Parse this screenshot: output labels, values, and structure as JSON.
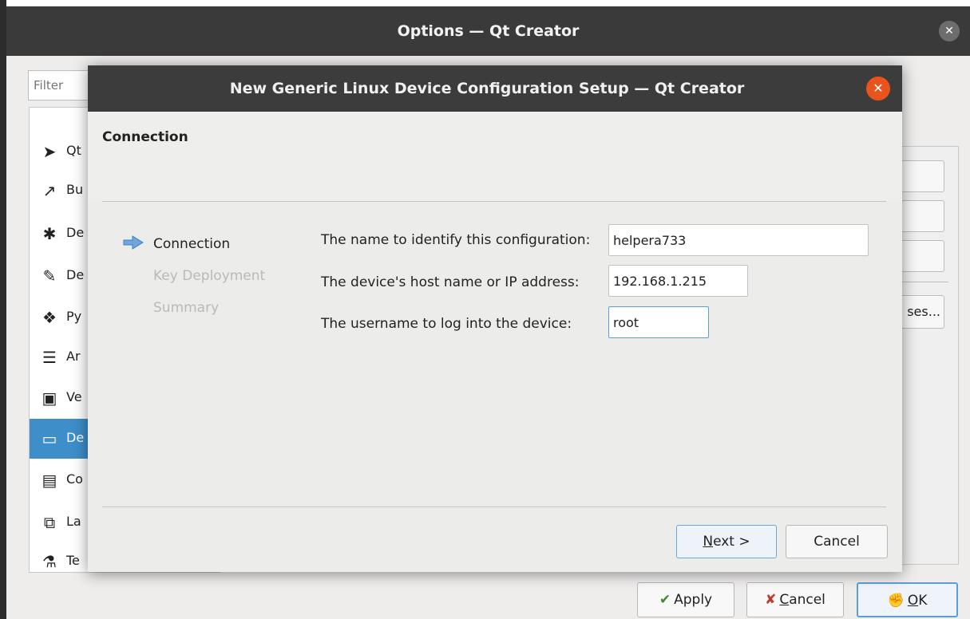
{
  "options_window": {
    "title": "Options — Qt Creator",
    "close_glyph": "✕",
    "filter_placeholder": "Filter",
    "categories": [
      {
        "label": "Qt",
        "icon": "paper-plane-icon",
        "glyph": "➤",
        "selected": false
      },
      {
        "label": "Bu",
        "icon": "hammer-icon",
        "glyph": "↗",
        "selected": false
      },
      {
        "label": "De",
        "icon": "bug-icon",
        "glyph": "✱",
        "selected": false
      },
      {
        "label": "De",
        "icon": "pencil-icon",
        "glyph": "✎",
        "selected": false
      },
      {
        "label": "Py",
        "icon": "python-icon",
        "glyph": "❖",
        "selected": false
      },
      {
        "label": "Ar",
        "icon": "text-align-icon",
        "glyph": "☰",
        "selected": false
      },
      {
        "label": "Ve",
        "icon": "version-control-icon",
        "glyph": "▣",
        "selected": false
      },
      {
        "label": "De",
        "icon": "devices-icon",
        "glyph": "▭",
        "selected": true
      },
      {
        "label": "Co",
        "icon": "clipboard-icon",
        "glyph": "▤",
        "selected": false
      },
      {
        "label": "La",
        "icon": "language-client-icon",
        "glyph": "⧉",
        "selected": false
      },
      {
        "label": "Te",
        "icon": "testing-flask-icon",
        "glyph": "⚗",
        "selected": false
      }
    ],
    "right_button_text": "ses...",
    "buttons": {
      "apply": "Apply",
      "cancel_prefix": "",
      "cancel_underlined": "C",
      "cancel_rest": "ancel",
      "ok_underlined": "O",
      "ok_rest": "K"
    }
  },
  "dialog": {
    "title": "New Generic Linux Device Configuration Setup — Qt Creator",
    "close_glyph": "✕",
    "page_heading": "Connection",
    "steps": [
      {
        "label": "Connection",
        "active": true
      },
      {
        "label": "Key Deployment",
        "active": false
      },
      {
        "label": "Summary",
        "active": false
      }
    ],
    "fields": {
      "name_label": "The name to identify this configuration:",
      "name_value": "helpera733",
      "host_label": "The device's host name or IP address:",
      "host_value": "192.168.1.215",
      "user_label": "The username to log into the device:",
      "user_value": "root"
    },
    "buttons": {
      "next_underlined": "N",
      "next_rest": "ext >",
      "cancel": "Cancel"
    }
  },
  "colors": {
    "accent": "#3d8ec9",
    "close_button": "#e9541d",
    "titlebar": "#3c3c3c"
  }
}
